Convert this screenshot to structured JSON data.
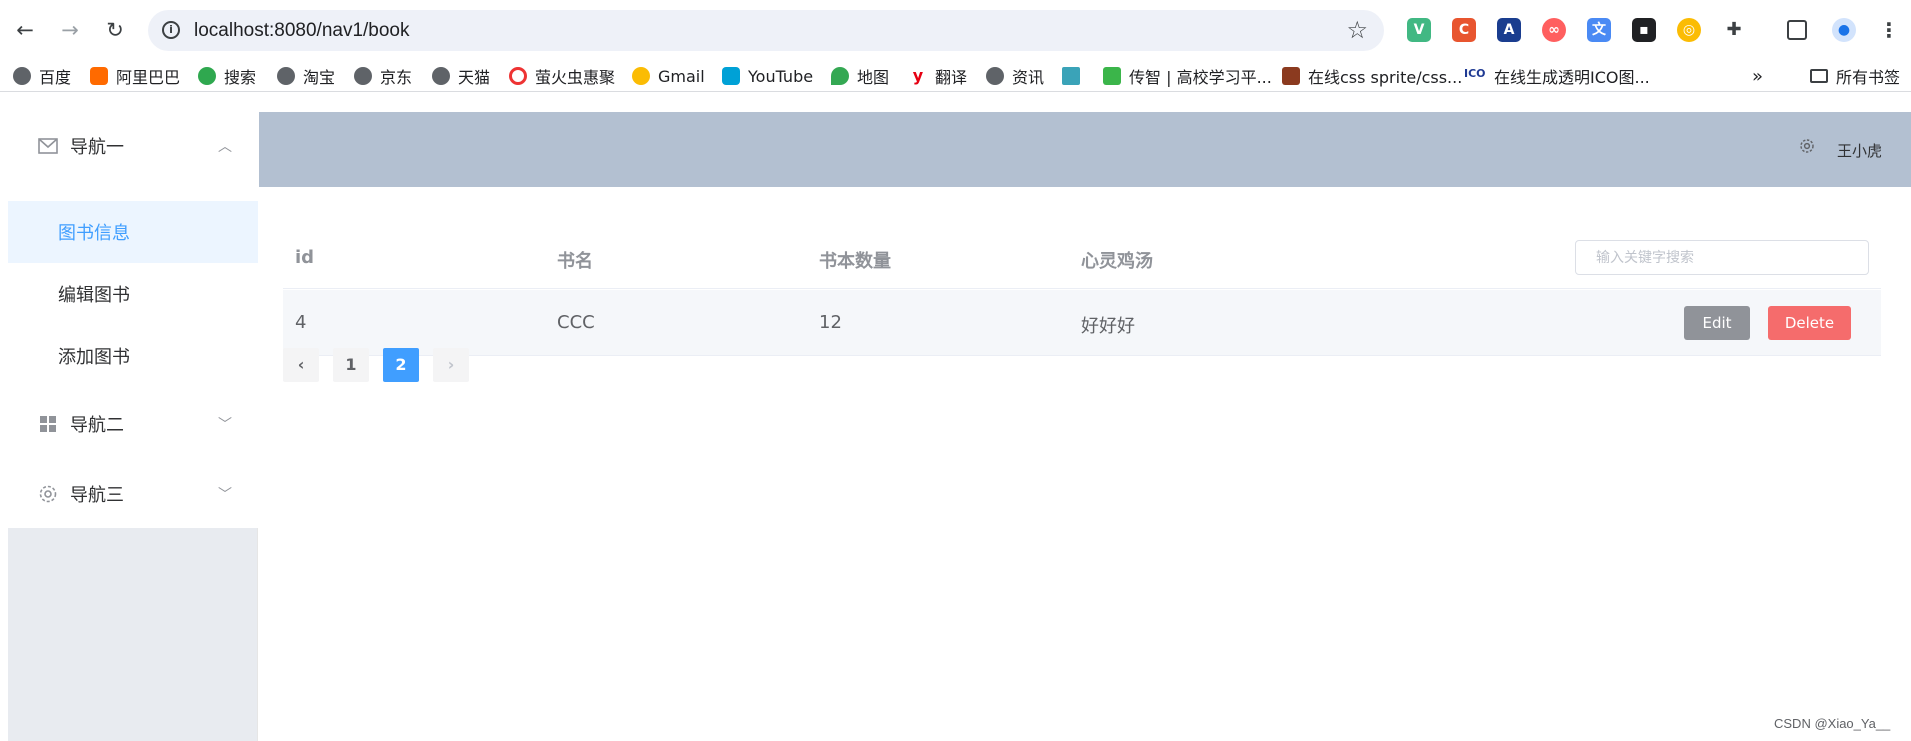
{
  "browser": {
    "url": "localhost:8080/nav1/book",
    "bookmarks": [
      "百度",
      "阿里巴巴",
      "搜索",
      "淘宝",
      "京东",
      "天猫",
      "萤火虫惠聚",
      "Gmail",
      "YouTube",
      "地图",
      "翻译",
      "资讯",
      "",
      "传智 | 高校学习平...",
      "在线css sprite/css...",
      "在线生成透明ICO图..."
    ],
    "bookmark_folder": "所有书签",
    "more": "»"
  },
  "sidebar": {
    "nav1": {
      "label": "导航一",
      "icon": "mail-icon",
      "expanded": true
    },
    "items": [
      {
        "label": "图书信息",
        "active": true
      },
      {
        "label": "编辑图书",
        "active": false
      },
      {
        "label": "添加图书",
        "active": false
      }
    ],
    "nav2": {
      "label": "导航二",
      "icon": "grid-icon"
    },
    "nav3": {
      "label": "导航三",
      "icon": "gear-icon"
    }
  },
  "header": {
    "username": "王小虎"
  },
  "table": {
    "columns": [
      "id",
      "书名",
      "书本数量",
      "心灵鸡汤"
    ],
    "search_placeholder": "输入关键字搜索",
    "rows": [
      {
        "id": "4",
        "name": "CCC",
        "count": "12",
        "soup": "好好好"
      }
    ],
    "edit_label": "Edit",
    "delete_label": "Delete"
  },
  "pagination": {
    "pages": [
      "1",
      "2"
    ],
    "current": "2"
  },
  "watermark": "CSDN @Xiao_Ya__",
  "colors": {
    "accent": "#409eff",
    "header_bg": "#b3c0d1",
    "danger": "#f56c6c",
    "info": "#909399"
  }
}
